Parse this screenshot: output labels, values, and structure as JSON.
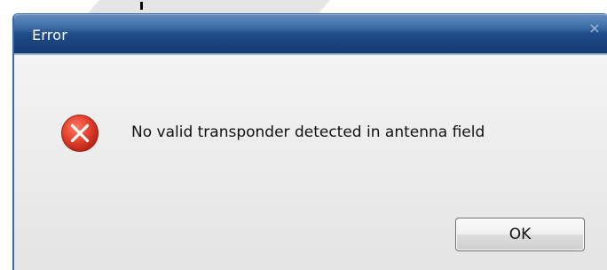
{
  "dialog": {
    "title": "Error",
    "close_glyph": "×",
    "message": "No valid transponder detected in antenna field",
    "icon": "error-icon",
    "ok_label": "OK"
  },
  "colors": {
    "titlebar": "#1e4a86",
    "error_icon": "#e23b2c",
    "dialog_body": "#eeeeee"
  }
}
